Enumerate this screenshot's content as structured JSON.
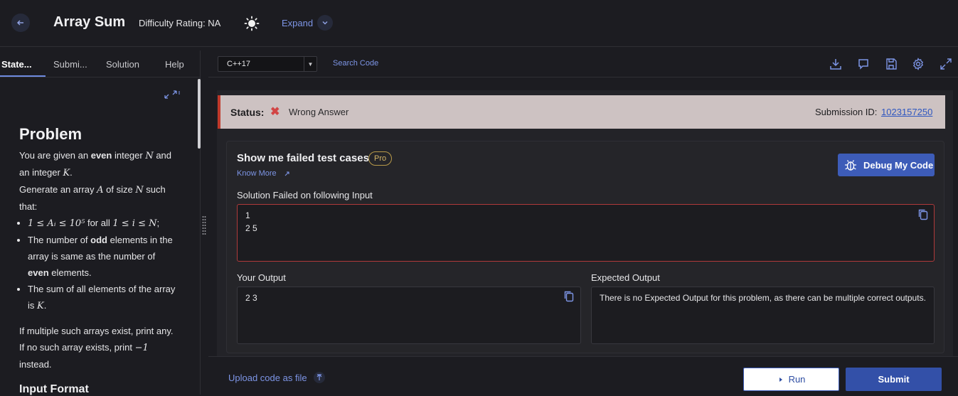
{
  "header": {
    "back_icon": "arrow-left-icon",
    "title": "Array Sum",
    "difficulty": "Difficulty Rating: NA",
    "theme_icon": "sun-icon",
    "expand_label": "Expand"
  },
  "left_tabs": [
    "State...",
    "Submi...",
    "Solution",
    "Help"
  ],
  "problem": {
    "heading": "Problem",
    "p1_a": "You are given an ",
    "p1_even": "even",
    "p1_b": " integer ",
    "p1_N": "N",
    "p1_c": " and an integer ",
    "p1_K": "K",
    "p1_d": ".",
    "p2_a": "Generate an array ",
    "p2_A": "A",
    "p2_b": " of size ",
    "p2_N": "N",
    "p2_c": " such that:",
    "li1_math1": "1 ≤ Aᵢ ≤ 10⁵",
    "li1_text": " for all ",
    "li1_math2": "1 ≤ i ≤ N",
    "li1_end": ";",
    "li2_a": "The number of ",
    "li2_odd": "odd",
    "li2_b": " elements in the array is same as the number of ",
    "li2_even": "even",
    "li2_c": " elements.",
    "li3_a": "The sum of all elements of the array is ",
    "li3_K": "K",
    "li3_b": ".",
    "p3_a": "If multiple such arrays exist, print any. If no such array exists, print ",
    "p3_m1": "−1",
    "p3_b": " instead.",
    "input_format": "Input Format"
  },
  "toolbar": {
    "language": "C++17",
    "search_code": "Search Code",
    "icons": [
      "download-icon",
      "comment-icon",
      "save-icon",
      "settings-icon",
      "fullscreen-icon"
    ]
  },
  "status": {
    "label": "Status:",
    "icon": "✖",
    "text": "Wrong Answer",
    "submission_label": "Submission ID:",
    "submission_id": "1023157250",
    "colors": {
      "bar_bg": "#cdc2c2",
      "error": "#d24545"
    }
  },
  "failed": {
    "title": "Show me failed test cases",
    "pro_badge": "Pro",
    "know_more": "Know More",
    "debug_button": "Debug My Code",
    "input_label": "Solution Failed on following Input",
    "input_value": "1\n2 5",
    "your_output_label": "Your Output",
    "your_output_value": "2 3",
    "expected_output_label": "Expected Output",
    "expected_output_value": "There is no Expected Output for this problem, as there can be multiple correct outputs."
  },
  "bottom": {
    "upload_label": "Upload code as file",
    "run_label": "Run",
    "submit_label": "Submit"
  },
  "colors": {
    "accent": "#3d5cb8",
    "link": "#7d95e6",
    "bg": "#1c1c21"
  }
}
